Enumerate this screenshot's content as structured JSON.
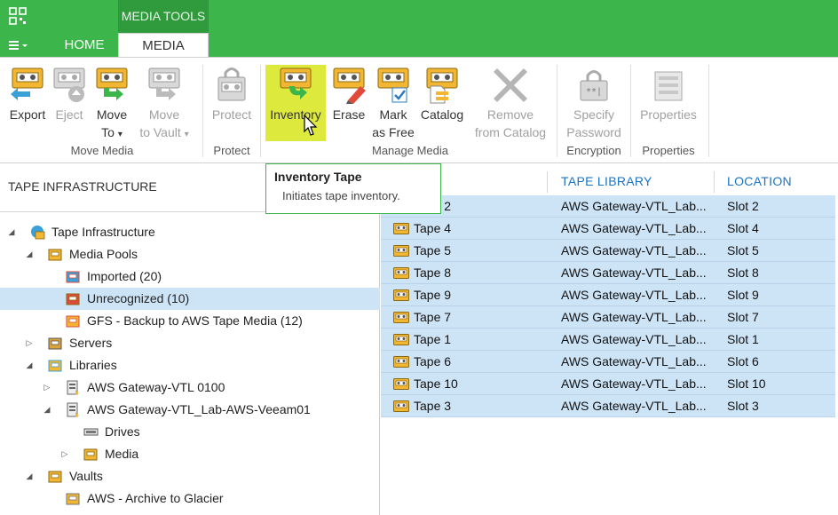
{
  "titlebar": {
    "context_tab": "MEDIA TOOLS",
    "accent_color": "#3cb54a",
    "app_icon": "grid-logo-icon"
  },
  "tabs": {
    "menu_icon": "hamburger-menu-icon",
    "home": "HOME",
    "media": "MEDIA"
  },
  "ribbon": {
    "buttons": {
      "export": [
        "Export",
        ""
      ],
      "eject": [
        "Eject",
        ""
      ],
      "move_to": [
        "Move",
        "To"
      ],
      "move_to_vault": [
        "Move",
        "to Vault"
      ],
      "protect": [
        "Protect",
        ""
      ],
      "inventory": [
        "Inventory",
        ""
      ],
      "erase": [
        "Erase",
        ""
      ],
      "mark_as_free": [
        "Mark",
        "as Free"
      ],
      "catalog": [
        "Catalog",
        ""
      ],
      "remove_from_catalog": [
        "Remove",
        "from Catalog"
      ],
      "specify_password": [
        "Specify",
        "Password"
      ],
      "properties": [
        "Properties",
        ""
      ]
    },
    "dropdown_arrow": "▾",
    "groups": {
      "move_media": "Move Media",
      "protect": "Protect",
      "manage_media": "Manage Media",
      "encryption": "Encryption",
      "properties": "Properties"
    }
  },
  "tooltip": {
    "title": "Inventory Tape",
    "description": "Initiates tape inventory."
  },
  "left_pane": {
    "title": "TAPE INFRASTRUCTURE",
    "tree": [
      {
        "label": "Tape Infrastructure",
        "icon": "tape-infrastructure-icon",
        "expander": "◢"
      },
      {
        "label": "Media Pools",
        "icon": "media-pool-icon",
        "expander": "◢"
      },
      {
        "label": "Imported (20)",
        "icon": "imported-pool-icon",
        "expander": ""
      },
      {
        "label": "Unrecognized (10)",
        "icon": "unrecognized-pool-icon",
        "expander": "",
        "selected": true
      },
      {
        "label": "GFS - Backup to AWS Tape Media (12)",
        "icon": "gfs-pool-icon",
        "expander": ""
      },
      {
        "label": "Servers",
        "icon": "servers-icon",
        "expander": "▷"
      },
      {
        "label": "Libraries",
        "icon": "libraries-icon",
        "expander": "◢"
      },
      {
        "label": "AWS Gateway-VTL 0100",
        "icon": "tape-library-icon",
        "expander": "▷"
      },
      {
        "label": "AWS Gateway-VTL_Lab-AWS-Veeam01",
        "icon": "tape-library-icon",
        "expander": "◢"
      },
      {
        "label": "Drives",
        "icon": "drive-icon",
        "expander": ""
      },
      {
        "label": "Media",
        "icon": "media-icon",
        "expander": "▷"
      },
      {
        "label": "Vaults",
        "icon": "vaults-icon",
        "expander": "◢"
      },
      {
        "label": "AWS - Archive to Glacier",
        "icon": "vault-icon",
        "expander": ""
      }
    ]
  },
  "grid": {
    "columns": [
      "",
      "TAPE LIBRARY",
      "LOCATION"
    ],
    "rows": [
      {
        "name": "Tape 2",
        "library": "AWS  Gateway-VTL_Lab...",
        "location": "Slot 2"
      },
      {
        "name": "Tape 4",
        "library": "AWS  Gateway-VTL_Lab...",
        "location": "Slot 4"
      },
      {
        "name": "Tape 5",
        "library": "AWS  Gateway-VTL_Lab...",
        "location": "Slot 5"
      },
      {
        "name": "Tape 8",
        "library": "AWS  Gateway-VTL_Lab...",
        "location": "Slot 8"
      },
      {
        "name": "Tape 9",
        "library": "AWS  Gateway-VTL_Lab...",
        "location": "Slot 9"
      },
      {
        "name": "Tape 7",
        "library": "AWS  Gateway-VTL_Lab...",
        "location": "Slot 7"
      },
      {
        "name": "Tape 1",
        "library": "AWS  Gateway-VTL_Lab...",
        "location": "Slot 1"
      },
      {
        "name": "Tape 6",
        "library": "AWS  Gateway-VTL_Lab...",
        "location": "Slot 6"
      },
      {
        "name": "Tape 10",
        "library": "AWS  Gateway-VTL_Lab...",
        "location": "Slot 10"
      },
      {
        "name": "Tape 3",
        "library": "AWS  Gateway-VTL_Lab...",
        "location": "Slot 3"
      }
    ],
    "row_icon": "tape-icon",
    "selection_color": "#cde4f7"
  }
}
